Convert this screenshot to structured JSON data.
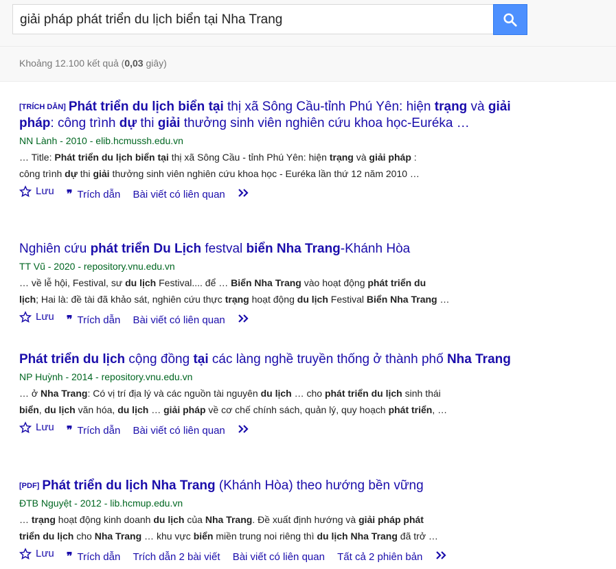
{
  "search": {
    "query": "giải pháp phát triển du lịch biển tại Nha Trang"
  },
  "stats": {
    "prefix": "Khoảng 12.100 kết quả (",
    "time": "0,03",
    "suffix": " giây)"
  },
  "actions": {
    "save": "Lưu",
    "cite": "Trích dẫn",
    "related": "Bài viết có liên quan",
    "cited_by": "Trích dẫn 2 bài viết",
    "all_versions": "Tất cả 2 phiên bản"
  },
  "results": [
    {
      "tag": "[TRÍCH DẪN]",
      "title_html": "<b>Phát triển du lịch biển tại</b> thị xã Sông Cầu-tỉnh Phú Yên: hiện <b>trạng</b> và <b>giải pháp</b>: công trình <b>dự</b> thi <b>giải</b> thưởng sinh viên nghiên cứu khoa học-Euréka …",
      "meta": "NN Lành - 2010 - elib.hcmussh.edu.vn",
      "snippet_html": "… Title: <b>Phát triển du lịch biển tại</b> thị xã Sông Cầu - tỉnh Phú Yên: hiện <b>trạng</b> và <b>giải pháp</b> :<br>công trình <b>dự</b> thi <b>giải</b> thưởng sinh viên nghiên cứu khoa học - Euréka lần thứ 12 năm 2010 …"
    },
    {
      "tag": "",
      "title_html": "Nghiên cứu <b>phát triển Du Lịch</b> festval <b>biển Nha Trang</b>-Khánh Hòa",
      "meta": "TT Vũ - 2020 - repository.vnu.edu.vn",
      "snippet_html": "… về lễ hội, Festival, sư <b>du lịch</b> Festival.... để … <b>Biển Nha Trang</b> vào hoạt động <b>phát triển du</b><br><b>lịch</b>; Hai là: đề tài đã khảo sát, nghiên cứu thực <b>trạng</b> hoạt động <b>du lịch</b> Festival <b>Biển Nha Trang</b> …"
    },
    {
      "tag": "",
      "title_html": "<b>Phát triển du lịch</b> cộng đồng <b>tại</b> các làng nghề truyền thống ở thành phố <b>Nha Trang</b>",
      "meta": "NP Huỳnh - 2014 - repository.vnu.edu.vn",
      "snippet_html": "… ở <b>Nha Trang</b>: Có vị trí địa lý và các nguồn tài nguyên <b>du lịch</b> … cho <b>phát triển du lịch</b> sinh thái<br><b>biển</b>, <b>du lịch</b> văn hóa, <b>du lịch</b> … <b>giải pháp</b> về cơ chế chính sách, quản lý, quy hoạch <b>phát triển</b>, …"
    },
    {
      "tag": "[PDF]",
      "title_html": "<b>Phát triển du lịch Nha Trang</b> (Khánh Hòa) theo hướng bền vững",
      "meta": "ĐTB Nguyệt - 2012 - lib.hcmup.edu.vn",
      "snippet_html": "… <b>trạng</b> hoạt động kinh doanh <b>du lịch</b> của <b>Nha Trang</b>. Đề xuất định hướng và <b>giải pháp phát</b><br><b>triển du lịch</b> cho <b>Nha Trang</b> … khu vực <b>biển</b> miền trung noi riêng thì <b>du lịch Nha Trang</b> đã trở …"
    }
  ]
}
